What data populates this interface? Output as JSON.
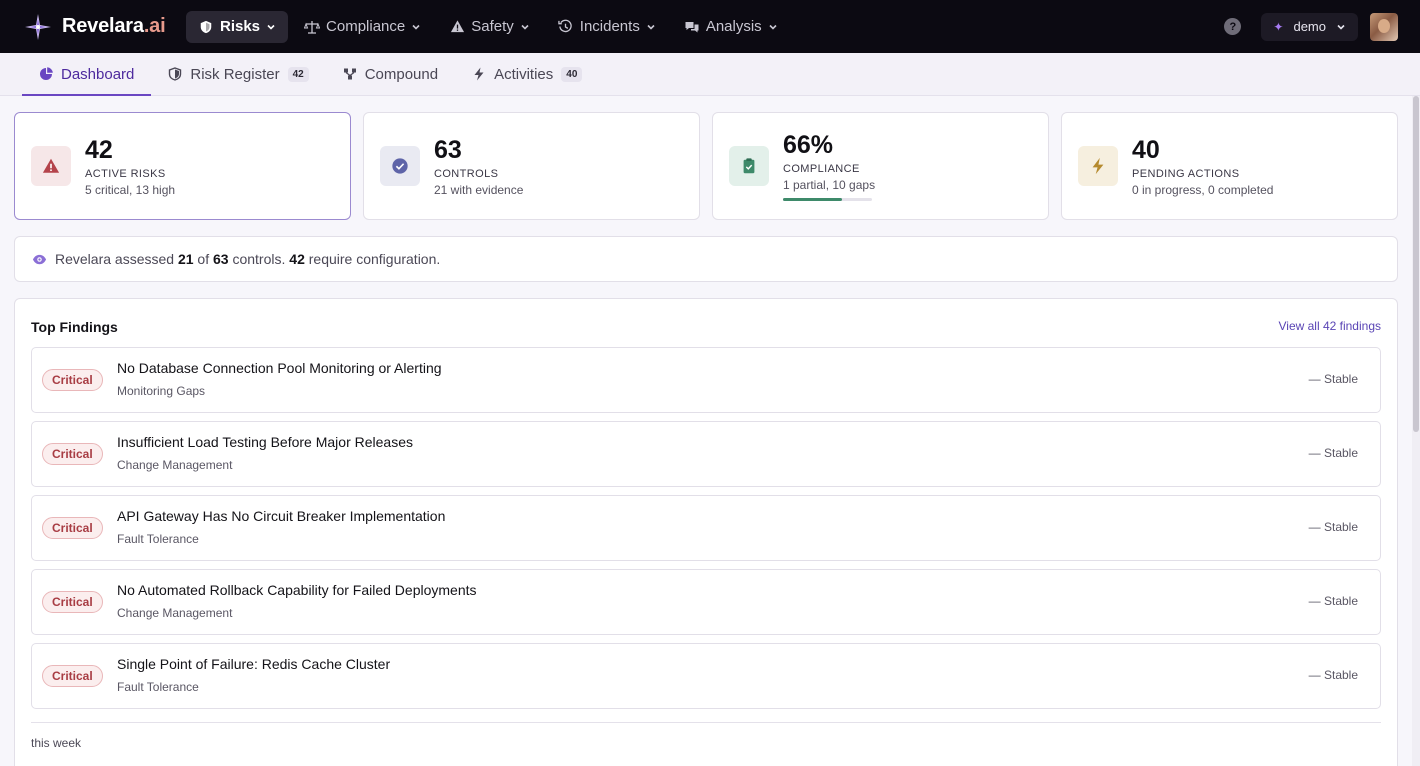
{
  "brand": {
    "name": "Revelara",
    "suffix": ".ai"
  },
  "nav": {
    "items": [
      {
        "label": "Risks",
        "icon": "shield-icon",
        "active": true
      },
      {
        "label": "Compliance",
        "icon": "scales-icon",
        "active": false
      },
      {
        "label": "Safety",
        "icon": "warning-triangle-icon",
        "active": false
      },
      {
        "label": "Incidents",
        "icon": "history-icon",
        "active": false
      },
      {
        "label": "Analysis",
        "icon": "chat-bubbles-icon",
        "active": false
      }
    ],
    "help": "?",
    "org": "demo"
  },
  "tabs": [
    {
      "label": "Dashboard",
      "icon": "pie-chart-icon",
      "active": true,
      "count": ""
    },
    {
      "label": "Risk Register",
      "icon": "shield-icon",
      "active": false,
      "count": "42"
    },
    {
      "label": "Compound",
      "icon": "nodes-icon",
      "active": false,
      "count": ""
    },
    {
      "label": "Activities",
      "icon": "lightning-icon",
      "active": false,
      "count": "40"
    }
  ],
  "cards": [
    {
      "value": "42",
      "label": "ACTIVE RISKS",
      "sub": "5 critical, 13 high",
      "icon": "alert-triangle-icon"
    },
    {
      "value": "63",
      "label": "CONTROLS",
      "sub": "21 with evidence",
      "icon": "check-circle-icon"
    },
    {
      "value": "66%",
      "label": "COMPLIANCE",
      "sub": "1 partial, 10 gaps",
      "icon": "clipboard-check-icon",
      "progress": 0.66
    },
    {
      "value": "40",
      "label": "PENDING ACTIONS",
      "sub": "0 in progress, 0 completed",
      "icon": "lightning-icon"
    }
  ],
  "banner": {
    "prefix": "Revelara assessed",
    "assessed": "21",
    "of": "of",
    "total": "63",
    "mid": "controls.",
    "require": "42",
    "suffix": "require configuration."
  },
  "findings": {
    "title": "Top Findings",
    "view_all": "View all 42 findings",
    "items": [
      {
        "severity": "Critical",
        "title": "No Database Connection Pool Monitoring or Alerting",
        "category": "Monitoring Gaps",
        "trend": "— Stable"
      },
      {
        "severity": "Critical",
        "title": "Insufficient Load Testing Before Major Releases",
        "category": "Change Management",
        "trend": "— Stable"
      },
      {
        "severity": "Critical",
        "title": "API Gateway Has No Circuit Breaker Implementation",
        "category": "Fault Tolerance",
        "trend": "— Stable"
      },
      {
        "severity": "Critical",
        "title": "No Automated Rollback Capability for Failed Deployments",
        "category": "Change Management",
        "trend": "— Stable"
      },
      {
        "severity": "Critical",
        "title": "Single Point of Failure: Redis Cache Cluster",
        "category": "Fault Tolerance",
        "trend": "— Stable"
      }
    ],
    "footer": "this week"
  },
  "colors": {
    "accent": "#6a47c2",
    "critical": "#a83d44",
    "compliance": "#3e8a6a",
    "topbar": "#0c0a12"
  }
}
